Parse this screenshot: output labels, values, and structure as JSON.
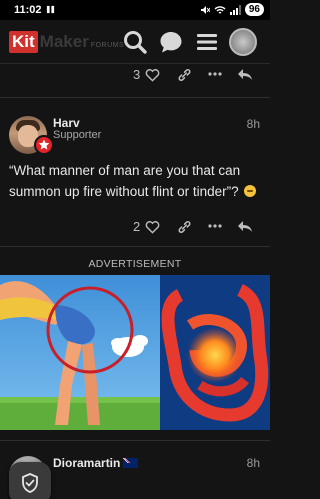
{
  "status_bar": {
    "time": "11:02",
    "battery": "96"
  },
  "header": {
    "logo_kit": "Kit",
    "logo_maker": "Maker",
    "logo_forums": "FORUMS",
    "icons": [
      "search-icon",
      "chat-icon",
      "menu-icon",
      "user-avatar"
    ]
  },
  "previous_post": {
    "like_count": "3"
  },
  "post": {
    "username": "Harv",
    "user_title": "Supporter",
    "time": "8h",
    "text": "“What manner of man are you that can summon up fire without flint or tinder”?",
    "emoji": "thinking-face",
    "like_count": "2"
  },
  "advertisement": {
    "label": "ADVERTISEMENT"
  },
  "next_post": {
    "username": "Dioramartin",
    "time": "8h",
    "flag": "australia-flag"
  },
  "colors": {
    "background": "#141414",
    "brand_red": "#d0312d",
    "badge_red": "#e2232a"
  }
}
